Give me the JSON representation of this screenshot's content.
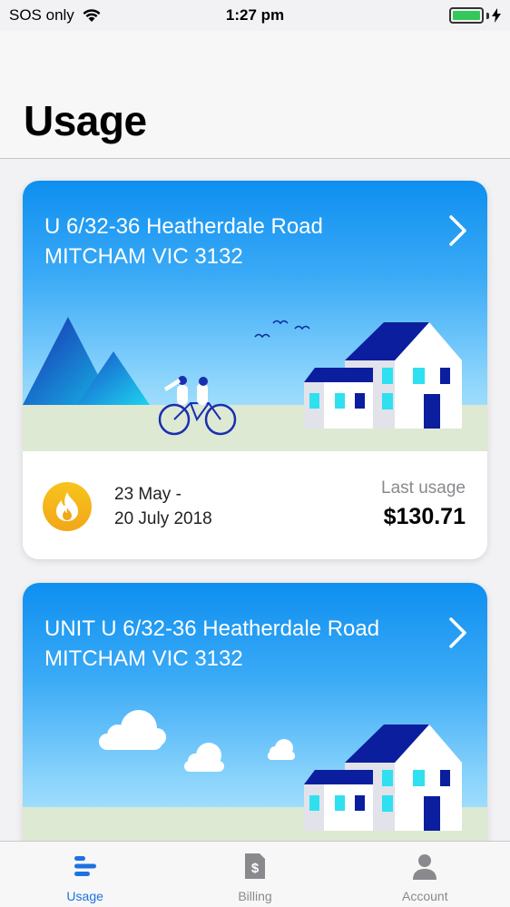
{
  "status_bar": {
    "carrier": "SOS only",
    "time": "1:27 pm",
    "battery_color": "#34c759"
  },
  "header": {
    "title": "Usage"
  },
  "cards": [
    {
      "address_line1": "U 6/32-36 Heatherdale Road",
      "address_line2": "MITCHAM VIC 3132",
      "period_line1": "23 May -",
      "period_line2": "20 July 2018",
      "usage_label": "Last usage",
      "usage_amount": "$130.71",
      "fuel_icon": "flame-icon",
      "badge_color": "#f5b51a"
    },
    {
      "address_line1": "UNIT U 6/32-36 Heatherdale Road",
      "address_line2": "MITCHAM VIC 3132"
    }
  ],
  "tabs": [
    {
      "label": "Usage",
      "icon": "usage-bars-icon",
      "active": true
    },
    {
      "label": "Billing",
      "icon": "billing-dollar-icon",
      "active": false
    },
    {
      "label": "Account",
      "icon": "account-person-icon",
      "active": false
    }
  ],
  "colors": {
    "accent": "#1c73e0",
    "hero_top": "#0e8ff0",
    "house_roof": "#0a1e9e",
    "window": "#2ee0f0"
  }
}
